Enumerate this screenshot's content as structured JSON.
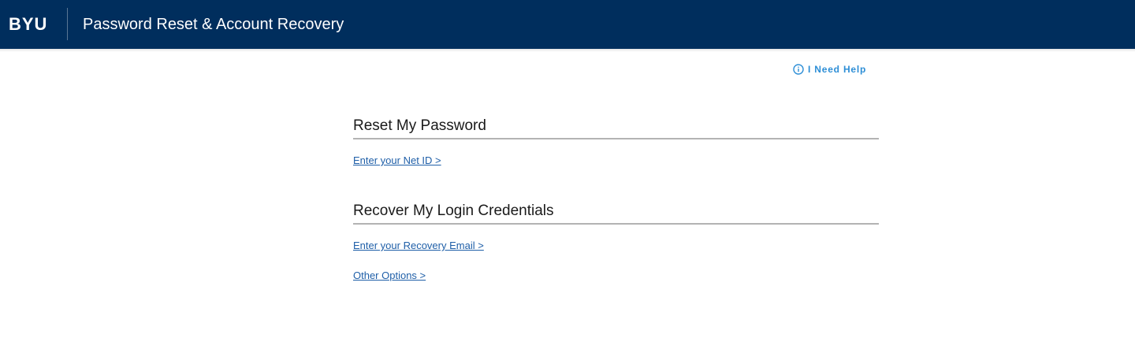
{
  "header": {
    "logo": "BYU",
    "title": "Password Reset & Account Recovery",
    "background_color": "#002e5d"
  },
  "help": {
    "icon": "info-circle-icon",
    "label": "I Need Help",
    "color": "#2d8ed6"
  },
  "sections": [
    {
      "title": "Reset My Password",
      "links": [
        "Enter your Net ID >"
      ]
    },
    {
      "title": "Recover My Login Credentials",
      "links": [
        "Enter your Recovery Email >",
        "Other Options >"
      ]
    }
  ],
  "link_color": "#1f5fa8"
}
